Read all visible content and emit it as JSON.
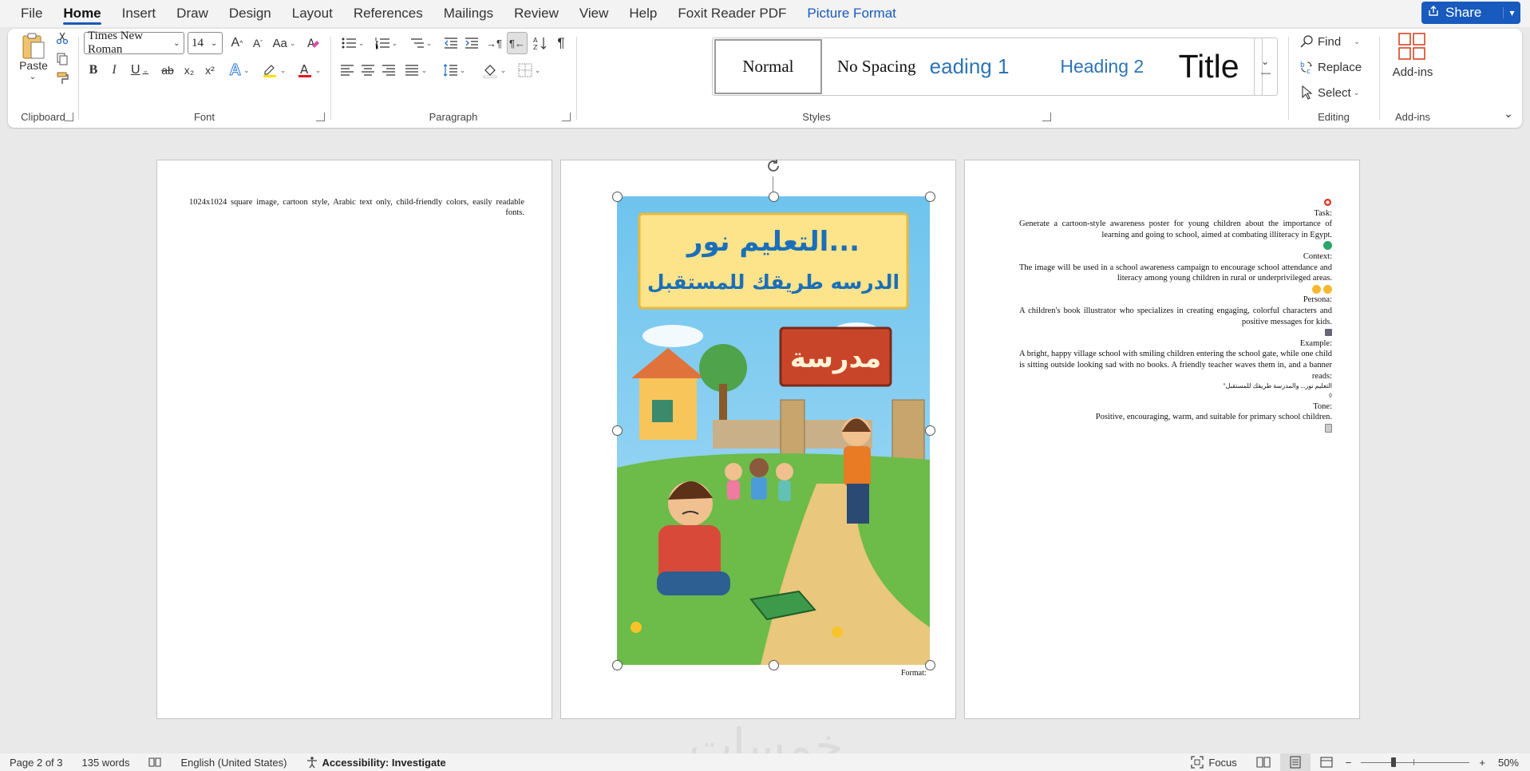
{
  "menu": {
    "items": [
      "File",
      "Home",
      "Insert",
      "Draw",
      "Design",
      "Layout",
      "References",
      "Mailings",
      "Review",
      "View",
      "Help",
      "Foxit Reader PDF"
    ],
    "active": "Home",
    "picture_format": "Picture Format",
    "share_label": "Share"
  },
  "ribbon": {
    "clipboard": {
      "paste_label": "Paste",
      "group_label": "Clipboard"
    },
    "font": {
      "font_name": "Times New Roman",
      "font_size": "14",
      "group_label": "Font",
      "bold": "B",
      "italic": "I",
      "underline": "U",
      "strike": "ab",
      "subscript": "x₂",
      "superscript": "x²",
      "grow": "A^",
      "shrink": "Aˇ",
      "change_case": "Aa",
      "highlight_color": "#ffe100",
      "font_color": "#e81123"
    },
    "paragraph": {
      "group_label": "Paragraph",
      "pilcrow": "¶"
    },
    "styles": {
      "group_label": "Styles",
      "items": [
        "Normal",
        "No Spacing",
        "eading 1",
        "Heading 2",
        "Title"
      ]
    },
    "editing": {
      "group_label": "Editing",
      "find": "Find",
      "replace": "Replace",
      "select": "Select"
    },
    "addins": {
      "label": "Add-ins",
      "group_label": "Add-ins"
    }
  },
  "document": {
    "page1_text": "1024x1024 square image, cartoon style, Arabic text only, child-friendly colors, easily readable fonts.",
    "poster": {
      "title": "التعليم نور...",
      "subtitle": "الدرسه طريقك للمستقبل",
      "sign": "مدرسة"
    },
    "format_label": "Format:",
    "page3": {
      "task_label": "Task:",
      "task": "Generate a cartoon-style awareness poster for young children about the importance of learning and going to school, aimed at combating illiteracy in Egypt.",
      "context_label": "Context:",
      "context": "The image will be used in a school awareness campaign to encourage school attendance and literacy among young children in rural or underprivileged areas.",
      "persona_label": "Persona:",
      "persona": "A children's book illustrator who specializes in creating engaging, colorful characters and positive messages for kids.",
      "example_label": "Example:",
      "example": "A bright, happy village school with smiling children entering the school gate, while one child is sitting outside looking sad with no books. A friendly teacher waves them in, and a banner reads:",
      "example_quote": "\"التعليم نور... والمدرسة طريقك للمستقبل",
      "tone_label": "Tone:",
      "tone": "Positive, encouraging, warm, and suitable for primary school children."
    }
  },
  "statusbar": {
    "page": "Page 2 of 3",
    "words": "135 words",
    "language": "English (United States)",
    "accessibility": "Accessibility: Investigate",
    "focus": "Focus",
    "zoom": "50%"
  },
  "colors": {
    "accent": "#185abd",
    "heading": "#2e74b5"
  }
}
